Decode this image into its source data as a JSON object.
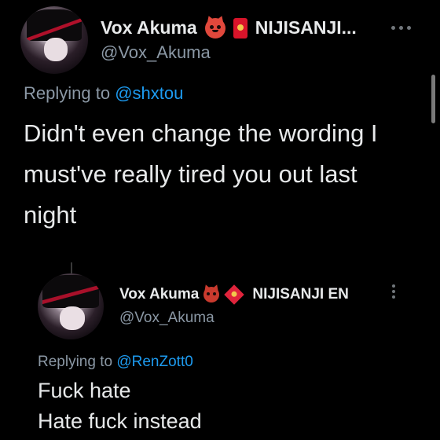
{
  "main_tweet": {
    "display_name": "Vox Akuma",
    "org_name": "NIJISANJI...",
    "handle": "@Vox_Akuma",
    "replying_prefix": "Replying to",
    "replying_to": "@shxtou",
    "text_lines": [
      "Didn't even change the wording I",
      "must've really tired you out last",
      "night"
    ]
  },
  "quoted_tweet": {
    "display_name": "Vox Akuma",
    "org_name": "NIJISANJI EN",
    "handle": "@Vox_Akuma",
    "replying_prefix": "Replying to",
    "replying_to": "@RenZott0",
    "text_lines": [
      "Fuck hate",
      "Hate fuck instead"
    ]
  },
  "icons": {
    "badge_demon": "ogre-face-icon",
    "badge_envelope": "red-envelope-icon",
    "more": "more-options-icon"
  },
  "colors": {
    "background": "#000000",
    "text_primary": "#e7e9ea",
    "text_secondary": "#8b98a5",
    "mention": "#1d9bf0"
  }
}
